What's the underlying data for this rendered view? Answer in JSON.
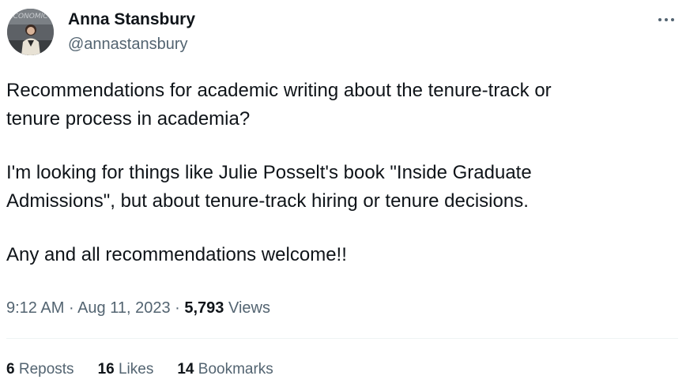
{
  "author": {
    "name": "Anna Stansbury",
    "handle": "@annastansbury",
    "avatar_text": "ECONOMIC"
  },
  "tweet": {
    "paragraphs": [
      "Recommendations for academic writing about the tenure-track or\ntenure process in academia?",
      "I'm looking for things like Julie Posselt's book \"Inside Graduate\nAdmissions\", but about tenure-track hiring or tenure decisions.",
      "Any and all recommendations welcome!!"
    ]
  },
  "meta": {
    "time": "9:12 AM",
    "sep1": " · ",
    "date": "Aug 11, 2023",
    "sep2": " · ",
    "views_count": "5,793",
    "views_label": "Views"
  },
  "stats": {
    "reposts_count": "6",
    "reposts_label": "Reposts",
    "likes_count": "16",
    "likes_label": "Likes",
    "bookmarks_count": "14",
    "bookmarks_label": "Bookmarks"
  },
  "icons": {
    "more": "more-horizontal-icon"
  },
  "colors": {
    "text_primary": "#0f1419",
    "text_secondary": "#536471",
    "divider": "#eff3f4"
  }
}
